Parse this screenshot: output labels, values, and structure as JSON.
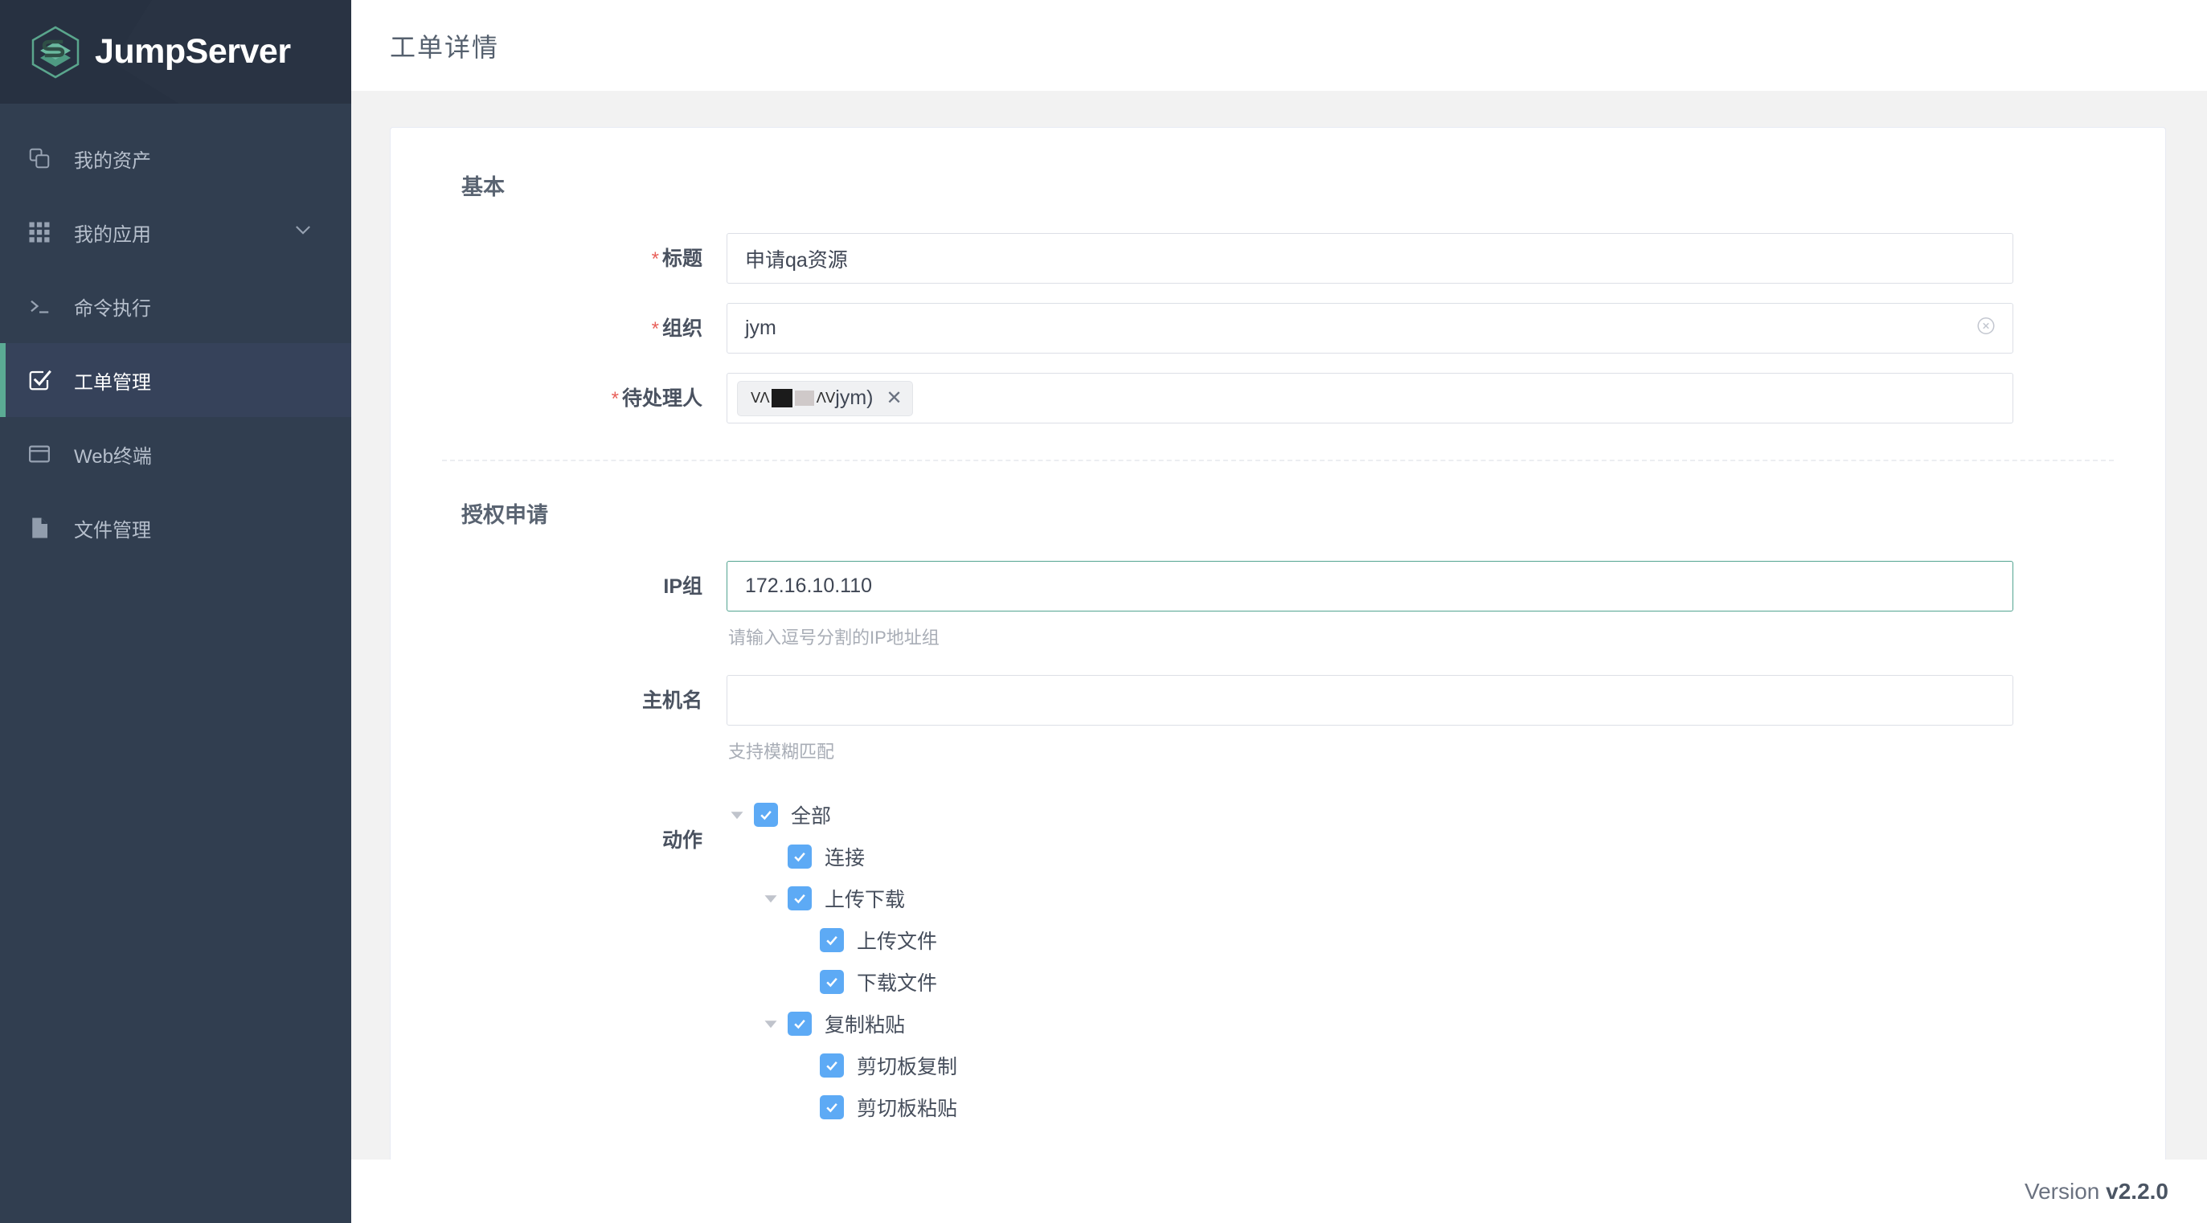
{
  "brand": {
    "name": "JumpServer",
    "logo_icon": "jumpserver-hexagon-logo",
    "logo_color": "#5aa68d"
  },
  "sidebar": {
    "items": [
      {
        "id": "my-assets",
        "label": "我的资产",
        "icon": "copy-icon",
        "active": false,
        "has_chevron": false
      },
      {
        "id": "my-apps",
        "label": "我的应用",
        "icon": "grid-icon",
        "active": false,
        "has_chevron": true
      },
      {
        "id": "command-exec",
        "label": "命令执行",
        "icon": "terminal-icon",
        "active": false,
        "has_chevron": false
      },
      {
        "id": "ticket-mgmt",
        "label": "工单管理",
        "icon": "check-square-icon",
        "active": true,
        "has_chevron": false
      },
      {
        "id": "web-terminal",
        "label": "Web终端",
        "icon": "window-icon",
        "active": false,
        "has_chevron": false
      },
      {
        "id": "file-mgmt",
        "label": "文件管理",
        "icon": "file-icon",
        "active": false,
        "has_chevron": false
      }
    ]
  },
  "header": {
    "title": "工单详情"
  },
  "form": {
    "basic": {
      "section_title": "基本",
      "fields": {
        "title": {
          "label": "标题",
          "required": true,
          "value": "申请qa资源"
        },
        "org": {
          "label": "组织",
          "required": true,
          "value": "jym",
          "clear_icon": "circle-close-icon"
        },
        "assignee": {
          "label": "待处理人",
          "required": true,
          "tag_text": "jym)",
          "tag_redacted": true,
          "tag_remove_icon": "close-icon"
        }
      }
    },
    "authorization": {
      "section_title": "授权申请",
      "fields": {
        "ip_group": {
          "label": "IP组",
          "required": false,
          "value": "172.16.10.110",
          "hint": "请输入逗号分割的IP地址组",
          "focused": true
        },
        "hostname": {
          "label": "主机名",
          "required": false,
          "value": "",
          "placeholder": "",
          "hint": "支持模糊匹配"
        },
        "actions": {
          "label": "动作",
          "tree": [
            {
              "label": "全部",
              "level": 1,
              "checked": true,
              "expandable": true
            },
            {
              "label": "连接",
              "level": 2,
              "checked": true,
              "expandable": false
            },
            {
              "label": "上传下载",
              "level": 2,
              "checked": true,
              "expandable": true
            },
            {
              "label": "上传文件",
              "level": 3,
              "checked": true,
              "expandable": false
            },
            {
              "label": "下载文件",
              "level": 3,
              "checked": true,
              "expandable": false
            },
            {
              "label": "复制粘贴",
              "level": 2,
              "checked": true,
              "expandable": true
            },
            {
              "label": "剪切板复制",
              "level": 3,
              "checked": true,
              "expandable": false
            },
            {
              "label": "剪切板粘贴",
              "level": 3,
              "checked": true,
              "expandable": false
            }
          ]
        }
      }
    }
  },
  "footer": {
    "version_label": "Version",
    "version_number": "v2.2.0"
  },
  "colors": {
    "sidebar_bg": "#313e50",
    "sidebar_header_bg": "#273141",
    "accent_green": "#5bab94",
    "focus_green": "#53a491",
    "checkbox_blue": "#5daaf5",
    "required_red": "#e8605a",
    "page_bg": "#f2f2f2"
  }
}
